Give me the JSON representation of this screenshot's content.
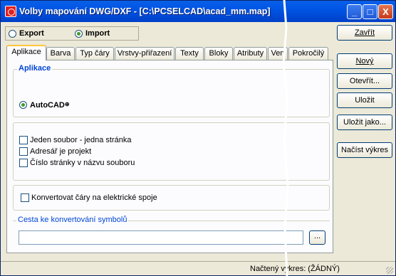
{
  "window": {
    "title": "Volby mapování DWG/DXF - [C:\\PCSELCAD\\acad_mm.map]"
  },
  "titlebar_buttons": {
    "minimize": "_",
    "maximize": "□",
    "close": "X"
  },
  "mode": {
    "export_label": "Export",
    "import_label": "Import",
    "selected": "Import"
  },
  "tabs": [
    "Aplikace",
    "Barva",
    "Typ čáry",
    "Vrstvy-přiřazení",
    "Texty",
    "Bloky",
    "Atributy",
    "Ven",
    "Pokročilý"
  ],
  "active_tab": "Aplikace",
  "app_group": {
    "title": "Aplikace",
    "option": "AutoCAD",
    "option_suffix": "⊕"
  },
  "checkboxes": {
    "one_file": "Jeden soubor - jedna stránka",
    "folder_project": "Adresář je projekt",
    "page_number": "Číslo stránky v názvu souboru"
  },
  "convert_lines": "Konvertovat čáry na elektrické spoje",
  "symbol_path": {
    "label": "Cesta ke konvertování symbolů",
    "value": "",
    "browse": "..."
  },
  "buttons": {
    "close": "Zavřít",
    "new": "Nový",
    "open": "Otevřít...",
    "save": "Uložit",
    "save_as": "Uložit jako...",
    "load_drawing": "Načíst výkres"
  },
  "status": {
    "text": "Načtený výkres: (ŽÁDNÝ)"
  },
  "colors": {
    "titlebar": "#0055e5",
    "face": "#ece9d8",
    "active_tab_accent": "#ffc73c",
    "group_title": "#0046d5"
  }
}
